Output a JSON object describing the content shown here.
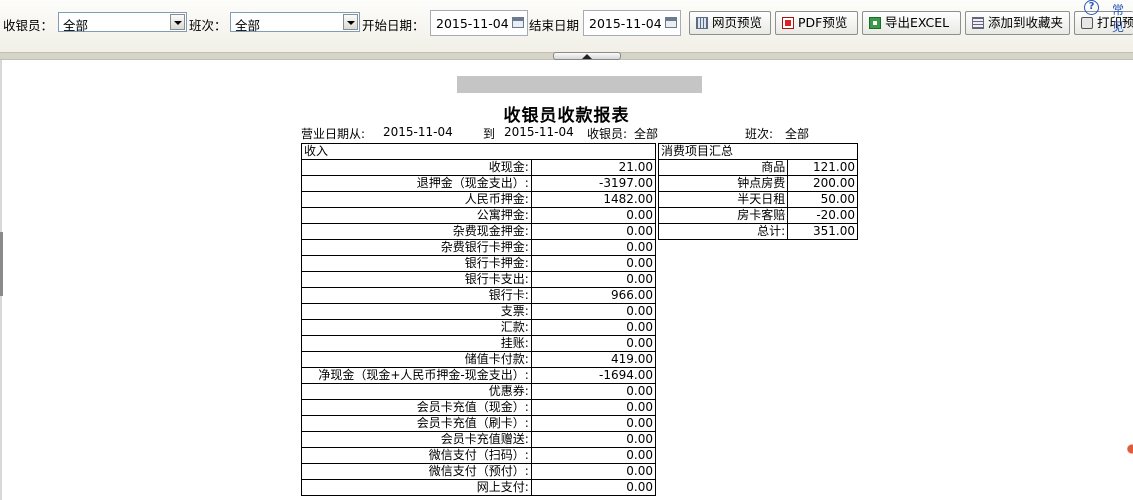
{
  "toolbar": {
    "cashier_label": "收银员：",
    "cashier_value": "全部",
    "shift_label": "班次：",
    "shift_value": "全部",
    "start_label": "开始日期：",
    "start_value": "2015-11-04",
    "end_label": "结束日期",
    "end_value": "2015-11-04",
    "buttons": {
      "web_preview": "网页预览",
      "pdf_preview": "PDF预览",
      "export_excel": "导出EXCEL",
      "add_favorite": "添加到收藏夹",
      "print_preview": "打印预"
    },
    "help_text": "常见"
  },
  "report": {
    "title": "收银员收款报表",
    "info": {
      "date_from_label": "营业日期从:",
      "date_from": "2015-11-04",
      "to_label": "到",
      "date_to": "2015-11-04",
      "cashier_label": "收银员:",
      "cashier": "全部",
      "shift_label": "班次:",
      "shift": "全部"
    },
    "income": {
      "header": "收入",
      "rows": [
        {
          "label": "收现金:",
          "value": "21.00"
        },
        {
          "label": "退押金（现金支出）:",
          "value": "-3197.00"
        },
        {
          "label": "人民币押金:",
          "value": "1482.00"
        },
        {
          "label": "公寓押金:",
          "value": "0.00"
        },
        {
          "label": "杂费现金押金:",
          "value": "0.00"
        },
        {
          "label": "杂费银行卡押金:",
          "value": "0.00"
        },
        {
          "label": "银行卡押金:",
          "value": "0.00"
        },
        {
          "label": "银行卡支出:",
          "value": "0.00"
        },
        {
          "label": "银行卡:",
          "value": "966.00"
        },
        {
          "label": "支票:",
          "value": "0.00"
        },
        {
          "label": "汇款:",
          "value": "0.00"
        },
        {
          "label": "挂账:",
          "value": "0.00"
        },
        {
          "label": "储值卡付款:",
          "value": "419.00"
        },
        {
          "label": "净现金（现金+人民币押金-现金支出）:",
          "value": "-1694.00"
        },
        {
          "label": "优惠券:",
          "value": "0.00"
        },
        {
          "label": "会员卡充值（现金）:",
          "value": "0.00"
        },
        {
          "label": "会员卡充值（刷卡）:",
          "value": "0.00"
        },
        {
          "label": "会员卡充值赠送:",
          "value": "0.00"
        },
        {
          "label": "微信支付（扫码）:",
          "value": "0.00"
        },
        {
          "label": "微信支付（预付）:",
          "value": "0.00"
        },
        {
          "label": "网上支付:",
          "value": "0.00"
        }
      ]
    },
    "consumption": {
      "header": "消费项目汇总",
      "rows": [
        {
          "label": "商品",
          "value": "121.00"
        },
        {
          "label": "钟点房费",
          "value": "200.00"
        },
        {
          "label": "半天日租",
          "value": "50.00"
        },
        {
          "label": "房卡客赔",
          "value": "-20.00"
        },
        {
          "label": "总计:",
          "value": "351.00"
        }
      ]
    }
  }
}
